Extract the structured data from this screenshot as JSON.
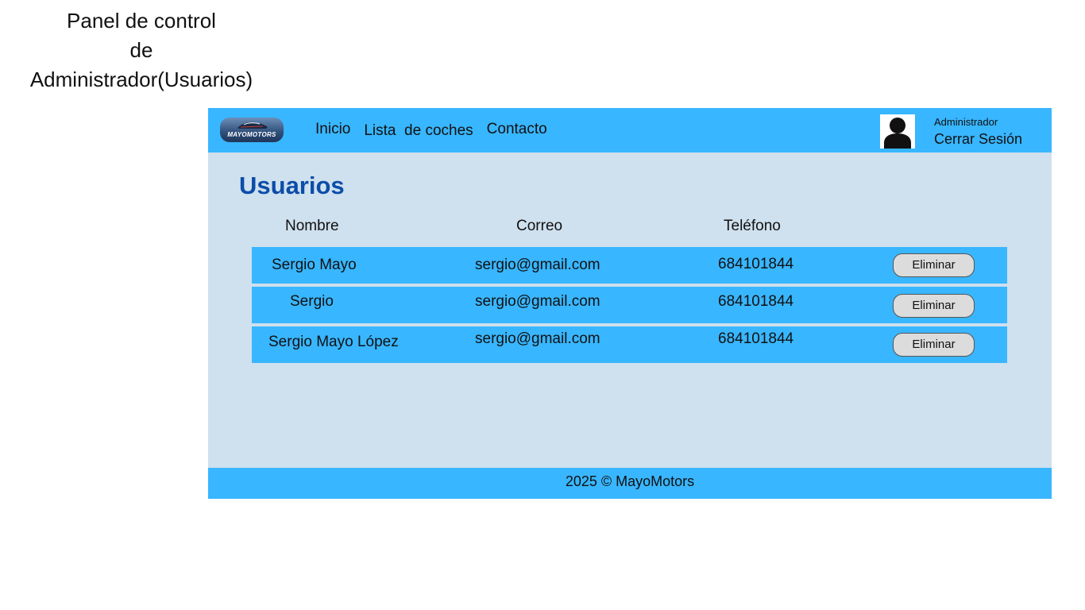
{
  "caption": {
    "line1": "Panel de control",
    "line2": "de",
    "line3": "Administrador(Usuarios)"
  },
  "navbar": {
    "logo_text": "MAYOMOTORS",
    "links": [
      "Inicio",
      "Lista  de coches",
      "Contacto"
    ],
    "user_role": "Administrador",
    "logout_label": "Cerrar Sesión",
    "avatar_icon": "user-avatar-icon"
  },
  "main": {
    "title": "Usuarios",
    "columns": [
      "Nombre",
      "Correo",
      "Teléfono"
    ],
    "rows": [
      {
        "nombre": "Sergio Mayo",
        "correo": "sergio@gmail.com",
        "telefono": "684101844",
        "action": "Eliminar"
      },
      {
        "nombre": "Sergio",
        "correo": "sergio@gmail.com",
        "telefono": "684101844",
        "action": "Eliminar"
      },
      {
        "nombre": "Sergio Mayo López",
        "correo": "sergio@gmail.com",
        "telefono": "684101844",
        "action": "Eliminar"
      }
    ]
  },
  "footer": {
    "text": "2025 © MayoMotors"
  },
  "colors": {
    "bar": "#38b6ff",
    "content_bg": "#cfe0ee",
    "title": "#0b4ea8",
    "button_bg": "#dcdcdc"
  }
}
